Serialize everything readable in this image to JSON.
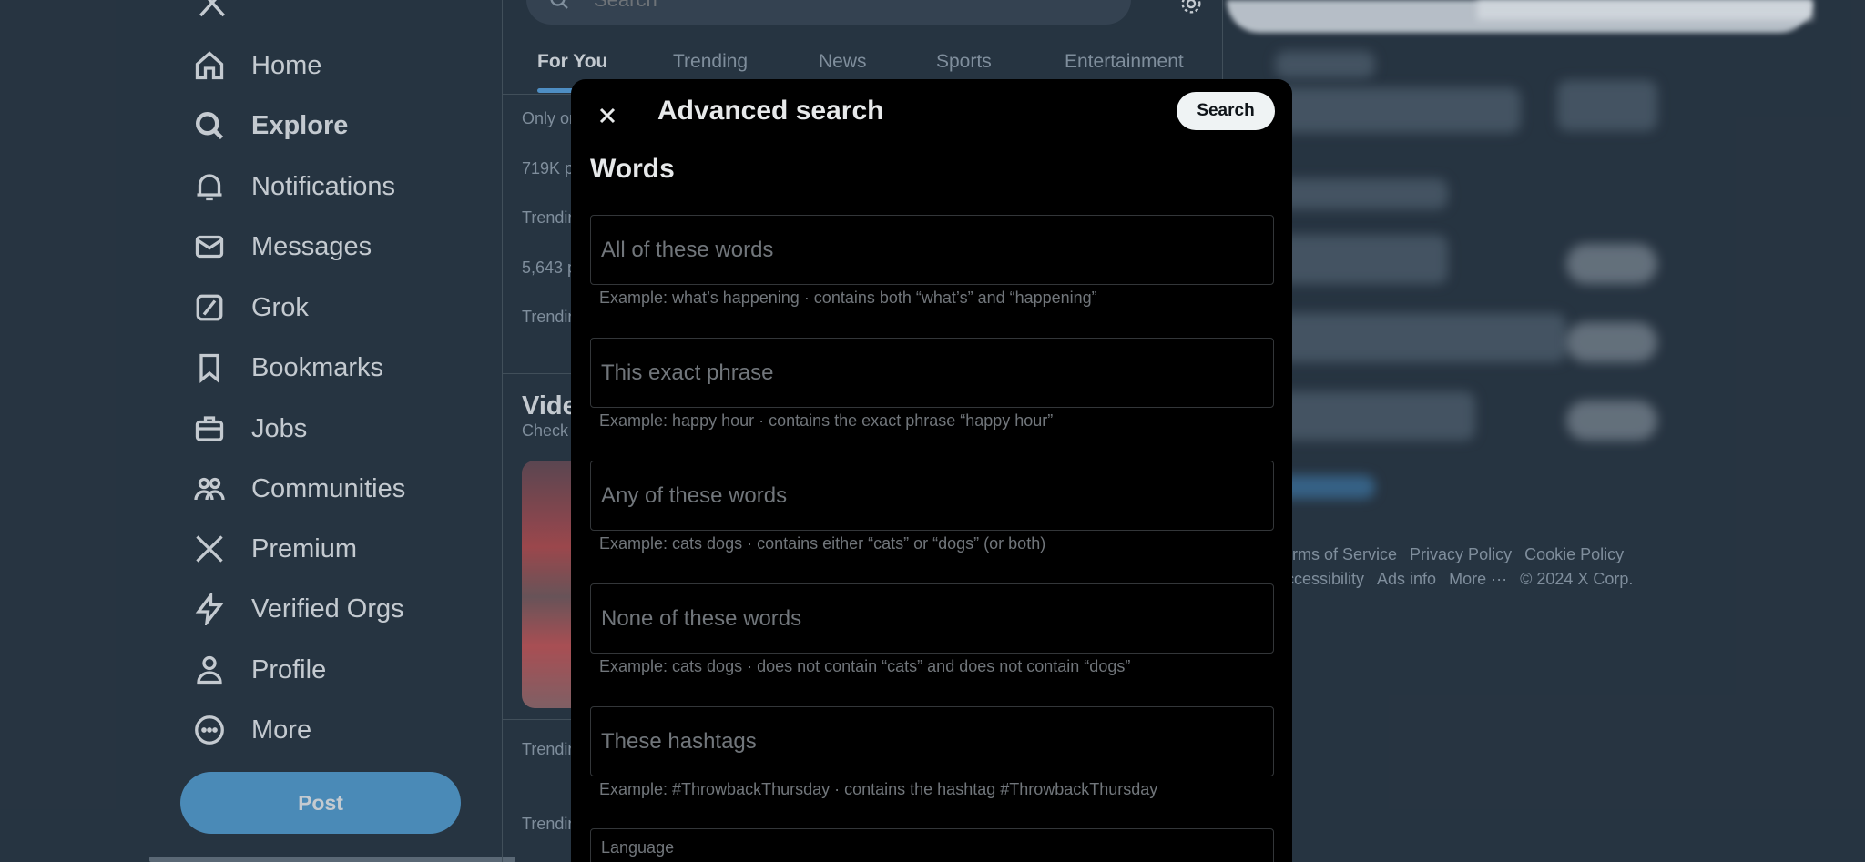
{
  "nav": {
    "items": [
      {
        "label": "Home",
        "icon": "home-icon"
      },
      {
        "label": "Explore",
        "icon": "search-icon"
      },
      {
        "label": "Notifications",
        "icon": "bell-icon"
      },
      {
        "label": "Messages",
        "icon": "envelope-icon"
      },
      {
        "label": "Grok",
        "icon": "grok-icon"
      },
      {
        "label": "Bookmarks",
        "icon": "bookmark-icon"
      },
      {
        "label": "Jobs",
        "icon": "briefcase-icon"
      },
      {
        "label": "Communities",
        "icon": "people-icon"
      },
      {
        "label": "Premium",
        "icon": "x-logo-icon"
      },
      {
        "label": "Verified Orgs",
        "icon": "lightning-icon"
      },
      {
        "label": "Profile",
        "icon": "person-icon"
      },
      {
        "label": "More",
        "icon": "more-circle-icon"
      }
    ],
    "active": "Explore",
    "post_label": "Post"
  },
  "explore": {
    "search_placeholder": "Search",
    "tabs": [
      "For You",
      "Trending",
      "News",
      "Sports",
      "Entertainment"
    ],
    "active_tab": "For You",
    "rows": [
      "Only on",
      "719K p",
      "Trendin",
      "5,643 p",
      "Trendin"
    ],
    "video_title": "Vide",
    "video_sub": "Check",
    "bottom_rows": [
      "Trendin",
      "Trendin"
    ]
  },
  "footer": {
    "links": [
      "Terms of Service",
      "Privacy Policy",
      "Cookie Policy",
      "Accessibility",
      "Ads info",
      "More ···",
      "© 2024 X Corp."
    ]
  },
  "modal": {
    "title": "Advanced search",
    "search_label": "Search",
    "section": "Words",
    "fields": [
      {
        "placeholder": "All of these words",
        "hint": "Example: what’s happening · contains both “what’s” and “happening”"
      },
      {
        "placeholder": "This exact phrase",
        "hint": "Example: happy hour · contains the exact phrase “happy hour”"
      },
      {
        "placeholder": "Any of these words",
        "hint": "Example: cats dogs · contains either “cats” or “dogs” (or both)"
      },
      {
        "placeholder": "None of these words",
        "hint": "Example: cats dogs · does not contain “cats” and does not contain “dogs”"
      },
      {
        "placeholder": "These hashtags",
        "hint": "Example: #ThrowbackThursday · contains the hashtag #ThrowbackThursday"
      }
    ],
    "language_label": "Language"
  },
  "colors": {
    "background": "#15202b",
    "modal_bg": "#000000",
    "accent": "#4493c9",
    "muted": "#71767b"
  }
}
